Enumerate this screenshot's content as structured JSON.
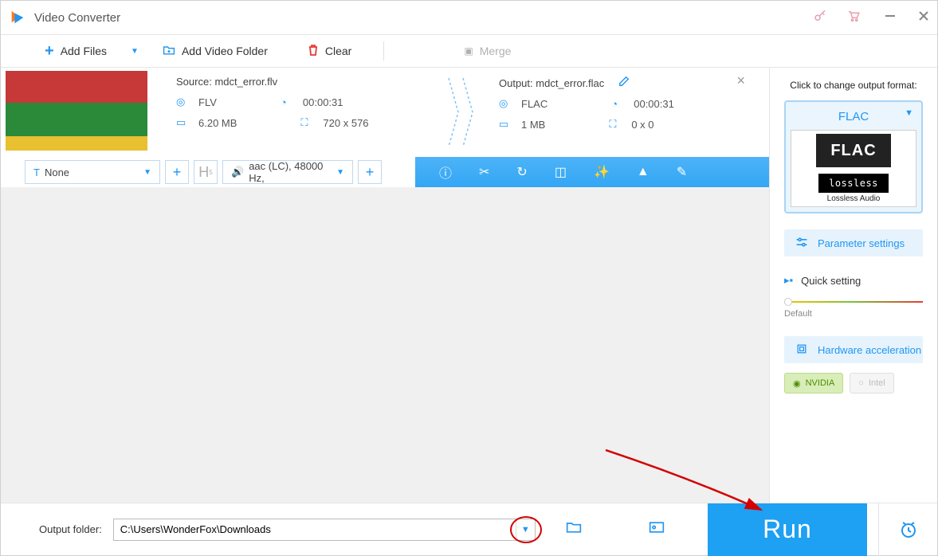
{
  "title": "Video Converter",
  "toolbar": {
    "add_files": "Add Files",
    "add_folder": "Add Video Folder",
    "clear": "Clear",
    "merge": "Merge"
  },
  "file": {
    "source_label": "Source:",
    "source_name": "mdct_error.flv",
    "output_label": "Output:",
    "output_name": "mdct_error.flac",
    "src": {
      "format": "FLV",
      "duration": "00:00:31",
      "size": "6.20 MB",
      "resolution": "720 x 576"
    },
    "dst": {
      "format": "FLAC",
      "duration": "00:00:31",
      "size": "1 MB",
      "resolution": "0 x 0"
    }
  },
  "actionbar": {
    "subtitle_option": "None",
    "audio_option": "aac (LC), 48000 Hz,"
  },
  "sidebar": {
    "hint": "Click to change output format:",
    "format": "FLAC",
    "format_big": "FLAC",
    "lossless_mark": "lossless",
    "lossless_sub": "Lossless Audio",
    "param_btn": "Parameter settings",
    "quick_setting": "Quick setting",
    "slider_label": "Default",
    "hw_accel": "Hardware acceleration",
    "nvidia": "NVIDIA",
    "intel": "Intel"
  },
  "bottom": {
    "output_folder_label": "Output folder:",
    "output_folder_path": "C:\\Users\\WonderFox\\Downloads",
    "run": "Run"
  }
}
